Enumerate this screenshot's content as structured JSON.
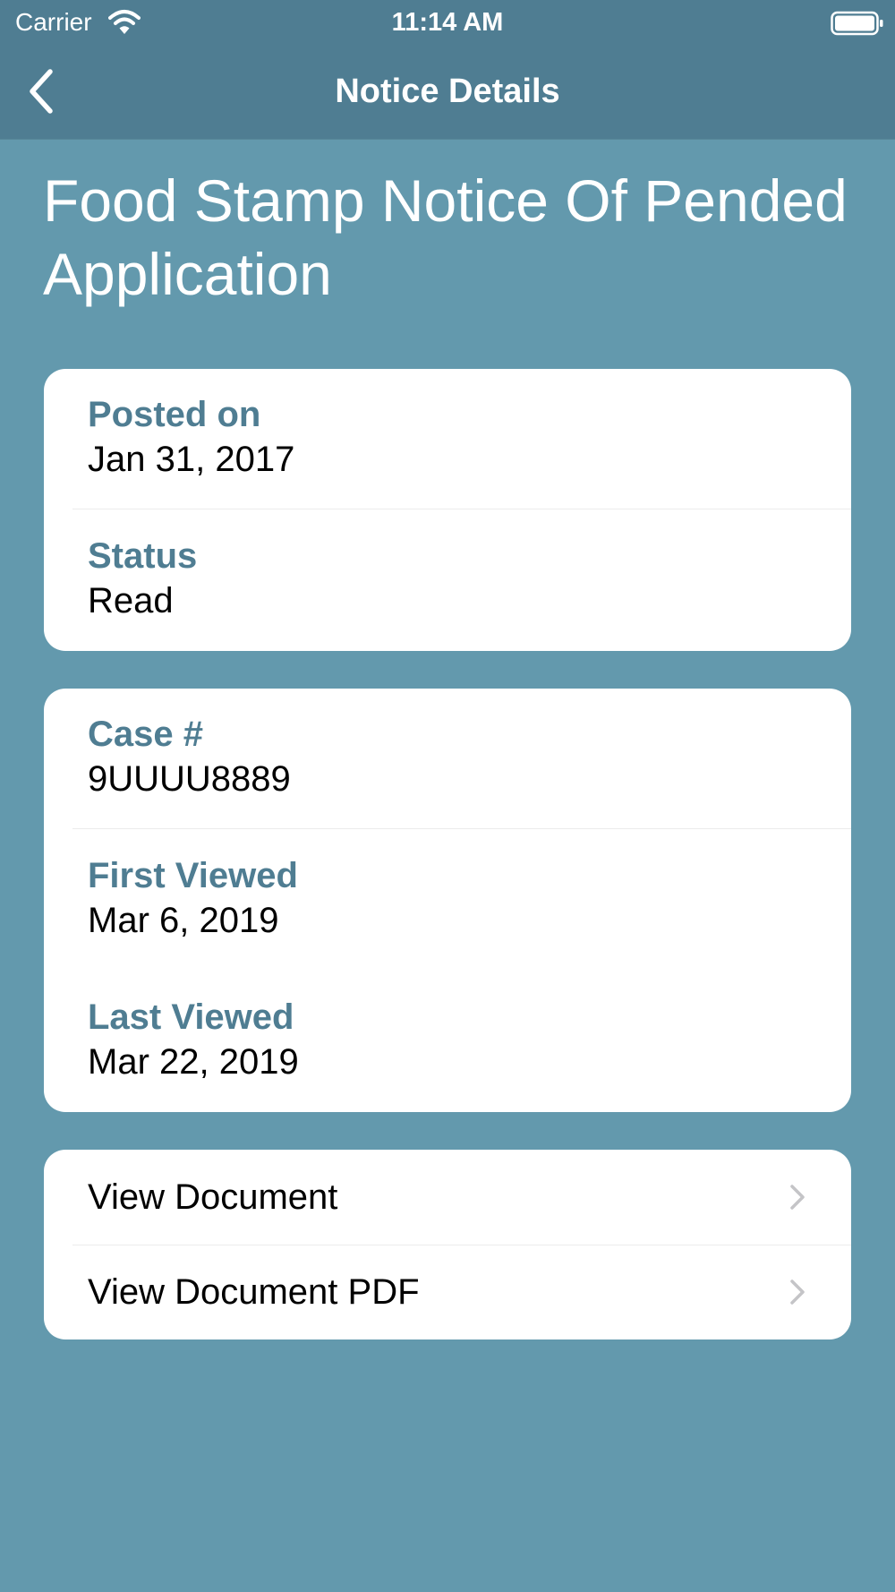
{
  "status_bar": {
    "carrier": "Carrier",
    "time": "11:14 AM"
  },
  "nav": {
    "title": "Notice Details",
    "back_icon": "chevron-left-icon"
  },
  "page": {
    "title": "Food Stamp Notice Of Pended Application"
  },
  "summary": {
    "posted_on_label": "Posted on",
    "posted_on_value": "Jan 31, 2017",
    "status_label": "Status",
    "status_value": "Read"
  },
  "details": {
    "case_label": "Case #",
    "case_value": "9UUUU8889",
    "first_viewed_label": "First Viewed",
    "first_viewed_value": "Mar 6, 2019",
    "last_viewed_label": "Last Viewed",
    "last_viewed_value": "Mar 22, 2019"
  },
  "actions": [
    {
      "label": "View Document",
      "icon": "chevron-right-icon"
    },
    {
      "label": "View Document PDF",
      "icon": "chevron-right-icon"
    }
  ],
  "colors": {
    "background": "#6399ad",
    "bar": "#4f7d92",
    "label_accent": "#4f7d92",
    "card": "#ffffff",
    "chevron": "#c4c4c7"
  }
}
